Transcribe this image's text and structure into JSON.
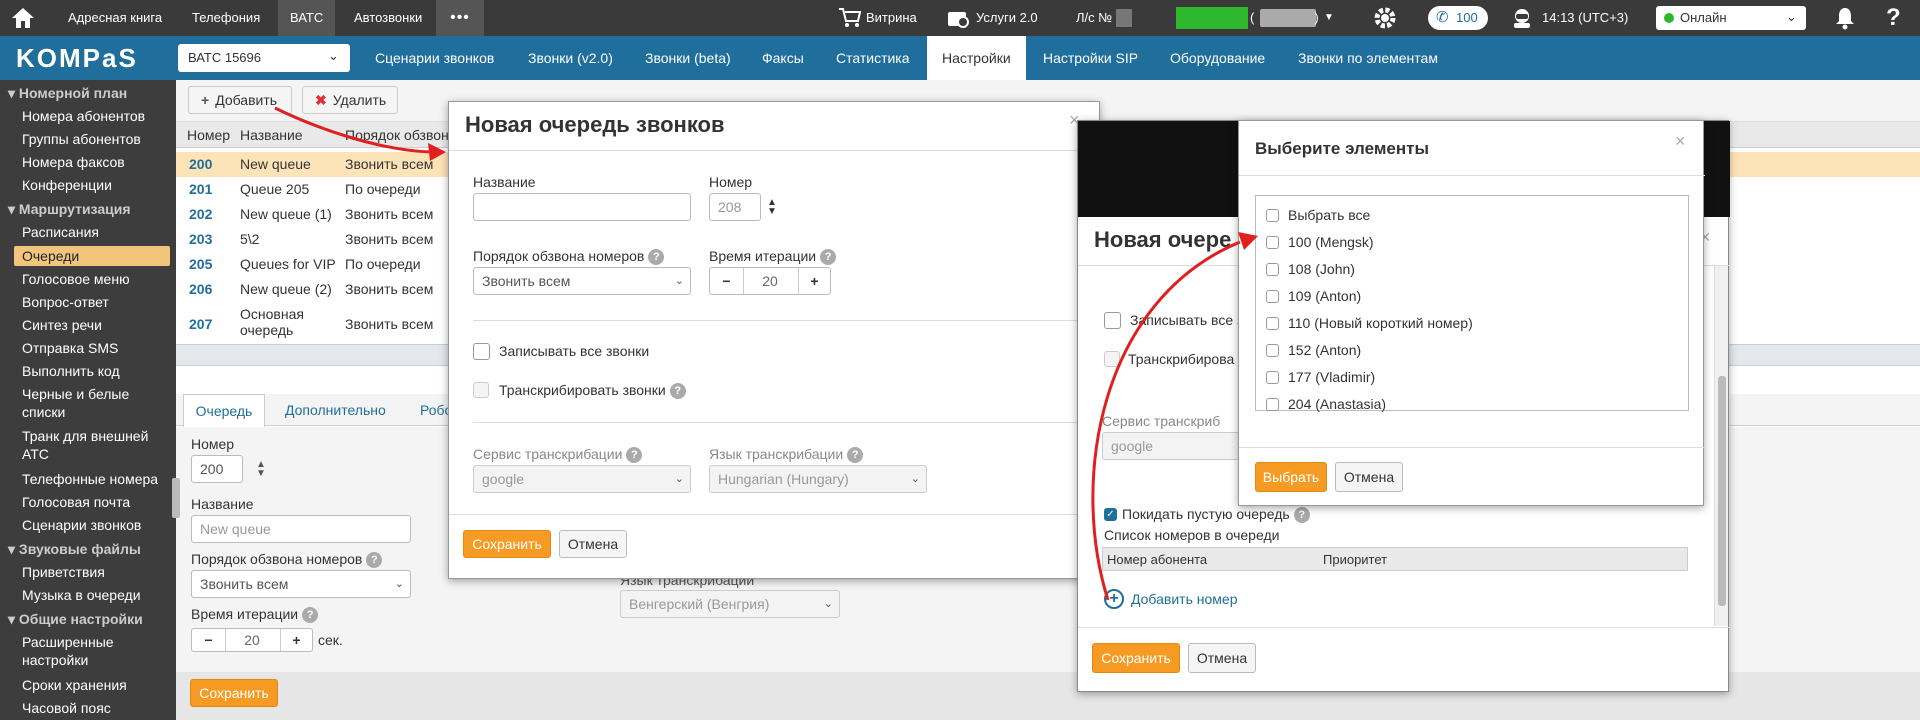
{
  "topbar": {
    "home_label": "",
    "items": [
      "Адресная книга",
      "Телефония",
      "ВАТС",
      "Автозвонки"
    ],
    "more": "•••",
    "vitrina": "Витрина",
    "services": "Услуги 2.0",
    "account_label": "Л/с №",
    "calls_count": "100",
    "time": "14:13 (UTC+3)",
    "status": "Онлайн"
  },
  "nav": {
    "logo": "KOMPaS",
    "vats_select": "ВАТС 15696",
    "tabs": [
      "Сценарии звонков",
      "Звонки (v2.0)",
      "Звонки (beta)",
      "Факсы",
      "Статистика",
      "Настройки",
      "Настройки SIP",
      "Оборудование",
      "Звонки по элементам"
    ],
    "active_tab": "Настройки"
  },
  "sidebar": {
    "items": [
      {
        "label": "Номерной план",
        "header": true
      },
      {
        "label": "Номера абонентов"
      },
      {
        "label": "Группы абонентов"
      },
      {
        "label": "Номера факсов"
      },
      {
        "label": "Конференции"
      },
      {
        "label": "Маршрутизация",
        "header": true
      },
      {
        "label": "Расписания"
      },
      {
        "label": "Очереди",
        "active": true
      },
      {
        "label": "Голосовое меню"
      },
      {
        "label": "Вопрос-ответ"
      },
      {
        "label": "Синтез речи"
      },
      {
        "label": "Отправка SMS"
      },
      {
        "label": "Выполнить код"
      },
      {
        "label": "Черные и белые списки"
      },
      {
        "label": "Транк для внешней АТС"
      },
      {
        "label": "Телефонные номера"
      },
      {
        "label": "Голосовая почта"
      },
      {
        "label": "Сценарии звонков"
      },
      {
        "label": "Звуковые файлы",
        "header": true
      },
      {
        "label": "Приветствия"
      },
      {
        "label": "Музыка в очереди"
      },
      {
        "label": "Общие настройки",
        "header": true
      },
      {
        "label": "Расширенные настройки"
      },
      {
        "label": "Сроки хранения"
      },
      {
        "label": "Часовой пояс"
      }
    ]
  },
  "toolbar": {
    "add": "Добавить",
    "delete": "Удалить"
  },
  "queue_table": {
    "headers": [
      "Номер",
      "Название",
      "Порядок обзвона"
    ],
    "rows": [
      {
        "number": "200",
        "name": "New queue",
        "order": "Звонить всем"
      },
      {
        "number": "201",
        "name": "Queue 205",
        "order": "По очереди"
      },
      {
        "number": "202",
        "name": "New queue (1)",
        "order": "Звонить всем"
      },
      {
        "number": "203",
        "name": "5\\2",
        "order": "Звонить всем"
      },
      {
        "number": "205",
        "name": "Queues for VIP",
        "order": "По очереди"
      },
      {
        "number": "206",
        "name": "New queue (2)",
        "order": "Звонить всем"
      },
      {
        "number": "207",
        "name": "Основная очередь",
        "order": "Звонить всем"
      }
    ]
  },
  "detail": {
    "tabs": [
      "Очередь",
      "Дополнительно",
      "Робо"
    ],
    "number_label": "Номер",
    "number_value": "200",
    "name_label": "Название",
    "name_placeholder": "New queue",
    "order_label": "Порядок обзвона номеров",
    "order_value": "Звонить всем",
    "iteration_label": "Время итерации",
    "iteration_value": "20",
    "seconds": "сек.",
    "lang_label": "Язык транскрибации",
    "lang_value": "Венгерский (Венгрия)",
    "save": "Сохранить"
  },
  "modal_new": {
    "title": "Новая очередь звонков",
    "name_label": "Название",
    "number_label": "Номер",
    "number_placeholder": "208",
    "order_label": "Порядок обзвона номеров",
    "order_value": "Звонить всем",
    "iteration_label": "Время итерации",
    "iteration_value": "20",
    "record_label": "Записывать все звонки",
    "transcribe_label": "Транскрибировать звонки",
    "service_label": "Сервис транскрибации",
    "service_value": "google",
    "lang_label": "Язык транскрибации",
    "lang_value": "Hungarian (Hungary)",
    "save": "Сохранить",
    "cancel": "Отмена"
  },
  "modal_back": {
    "title": "Новая очере",
    "record_label": "Записывать все з",
    "transcribe_label": "Транскрибирова",
    "service_label": "Сервис транскриб",
    "service_value": "google",
    "leave_empty_label": "Покидать пустую очередь",
    "list_label": "Список номеров в очереди",
    "col_subscriber": "Номер абонента",
    "col_priority": "Приоритет",
    "add_number": "Добавить номер",
    "save": "Сохранить",
    "cancel": "Отмена"
  },
  "modal_select": {
    "title": "Выберите элементы",
    "options": [
      "Выбрать все",
      "100 (Mengsk)",
      "108 (John)",
      "109 (Anton)",
      "110 (Новый короткий номер)",
      "152 (Anton)",
      "177 (Vladimir)",
      "204 (Anastasia)"
    ],
    "select": "Выбрать",
    "cancel": "Отмена"
  },
  "colors": {
    "nav": "#1f6e9c",
    "topbar": "#3a3a3a",
    "sidebar": "#3d3d3d",
    "accent": "#f59a23",
    "row_highlight": "#fde3b8",
    "green": "#2eb82e",
    "arrow": "#e02020"
  }
}
